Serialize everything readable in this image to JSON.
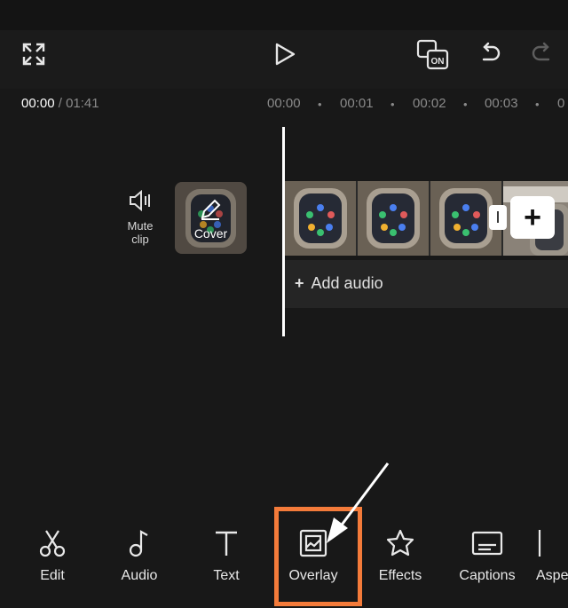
{
  "time": {
    "current": "00:00",
    "separator": " / ",
    "total": "01:41"
  },
  "ruler": [
    "00:00",
    "00:01",
    "00:02",
    "00:03",
    "0"
  ],
  "track": {
    "mute_label_line1": "Mute",
    "mute_label_line2": "clip",
    "cover_label": "Cover"
  },
  "audio": {
    "plus": "+",
    "label": "Add audio"
  },
  "add_clip_label": "+",
  "tools": [
    {
      "label": "Edit",
      "icon": "scissors-icon"
    },
    {
      "label": "Audio",
      "icon": "music-note-icon"
    },
    {
      "label": "Text",
      "icon": "text-icon"
    },
    {
      "label": "Overlay",
      "icon": "overlay-icon"
    },
    {
      "label": "Effects",
      "icon": "effects-star-icon"
    },
    {
      "label": "Captions",
      "icon": "captions-icon"
    },
    {
      "label": "Aspe",
      "icon": "aspect-icon"
    }
  ],
  "colors": {
    "highlight": "#f47b3a",
    "background": "#181818"
  }
}
